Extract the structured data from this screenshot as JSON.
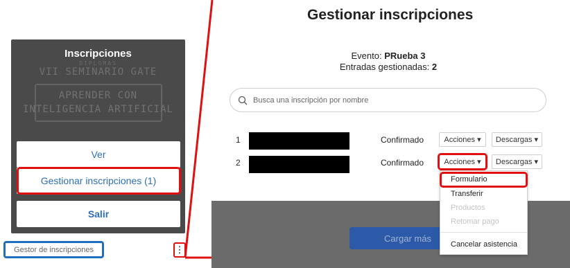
{
  "left_card": {
    "title": "Inscripciones",
    "bg_small": "DIPLOMAS",
    "bg_seminar": "VII SEMINARIO GATE",
    "bg_line1": "APRENDER CON",
    "bg_line2": "INTELIGENCIA ARTIFICIAL",
    "buttons": {
      "ver": "Ver",
      "gestionar": "Gestionar inscripciones (1)",
      "salir": "Salir"
    }
  },
  "footer": {
    "gestor_link": "Gestor de inscripciones",
    "kebab_icon": "more-vertical-icon"
  },
  "main": {
    "title": "Gestionar inscripciones",
    "event_label": "Evento:",
    "event_value": "PRueba 3",
    "entries_label": "Entradas gestionadas:",
    "entries_value": "2",
    "search_placeholder": "Busca una inscripción por nombre",
    "rows": [
      {
        "num": "1",
        "status": "Confirmado",
        "actions": "Acciones",
        "downloads": "Descargas"
      },
      {
        "num": "2",
        "status": "Confirmado",
        "actions": "Acciones",
        "downloads": "Descargas"
      }
    ],
    "load_more": "Cargar más"
  },
  "actions_menu": {
    "items": [
      {
        "label": "Formulario",
        "enabled": true
      },
      {
        "label": "Transferir",
        "enabled": true
      },
      {
        "label": "Productos",
        "enabled": false
      },
      {
        "label": "Retomar pago",
        "enabled": false
      },
      {
        "label": "Cancelar asistencia",
        "enabled": true
      }
    ]
  },
  "colors": {
    "highlight_red": "#e01010",
    "highlight_blue": "#1f6fc0",
    "link_blue": "#2e6fb5",
    "button_blue": "#2d5aa8"
  }
}
